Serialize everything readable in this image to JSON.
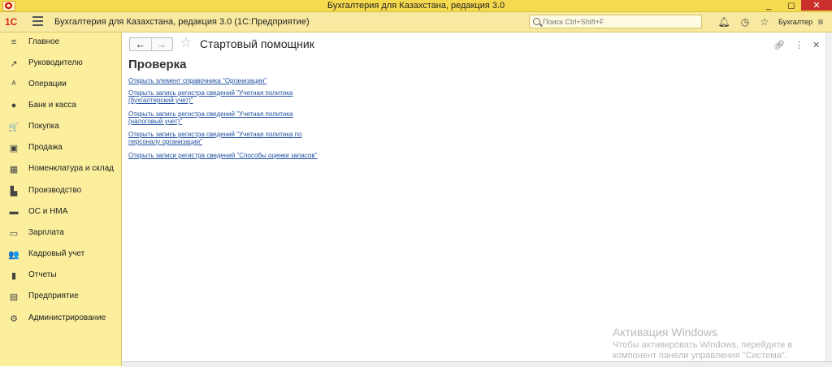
{
  "window": {
    "title": "Бухгалтерия для Казахстана, редакция 3.0",
    "controls": [
      "_",
      "◻",
      "✕"
    ]
  },
  "toolbar": {
    "logo": "1С",
    "app_name": "Бухгалтерия для Казахстана, редакция 3.0  (1С:Предприятие)",
    "search_placeholder": "Поиск Ctrl+Shift+F",
    "user": "Бухгалтер",
    "icons": [
      "bell-icon",
      "history-icon",
      "star-icon",
      "user-menu-icon"
    ]
  },
  "sidebar": {
    "items": [
      {
        "label": "Главное",
        "icon": "≡"
      },
      {
        "label": "Руководителю",
        "icon": "↗"
      },
      {
        "label": "Операции",
        "icon": "ᴬ"
      },
      {
        "label": "Банк и касса",
        "icon": "●"
      },
      {
        "label": "Покупка",
        "icon": "🛒"
      },
      {
        "label": "Продажа",
        "icon": "▣"
      },
      {
        "label": "Номенклатура и склад",
        "icon": "▦"
      },
      {
        "label": "Производство",
        "icon": "▙"
      },
      {
        "label": "ОС и НМА",
        "icon": "▬"
      },
      {
        "label": "Зарплата",
        "icon": "▭"
      },
      {
        "label": "Кадровый учет",
        "icon": "👥"
      },
      {
        "label": "Отчеты",
        "icon": "▮"
      },
      {
        "label": "Предприятие",
        "icon": "▤"
      },
      {
        "label": "Администрирование",
        "icon": "⚙"
      }
    ]
  },
  "main": {
    "title": "Стартовый помощник",
    "section": "Проверка",
    "links": [
      "Открыть элемент справочника \"Организации\"",
      "Открыть запись регистра сведений \"Учетная политика (бухгалтерский учет)\"",
      "Открыть запись регистра сведений \"Учетная политика (налоговый учет)\"",
      "Открыть запись регистра сведений \"Учетная политика по персоналу организации\"",
      "Открыть записи регистра сведений \"Способы оценки запасов\""
    ]
  },
  "watermark": {
    "line1": "Активация Windows",
    "line2": "Чтобы активировать Windows, перейдите в",
    "line3": "компонент панели управления \"Система\"."
  }
}
